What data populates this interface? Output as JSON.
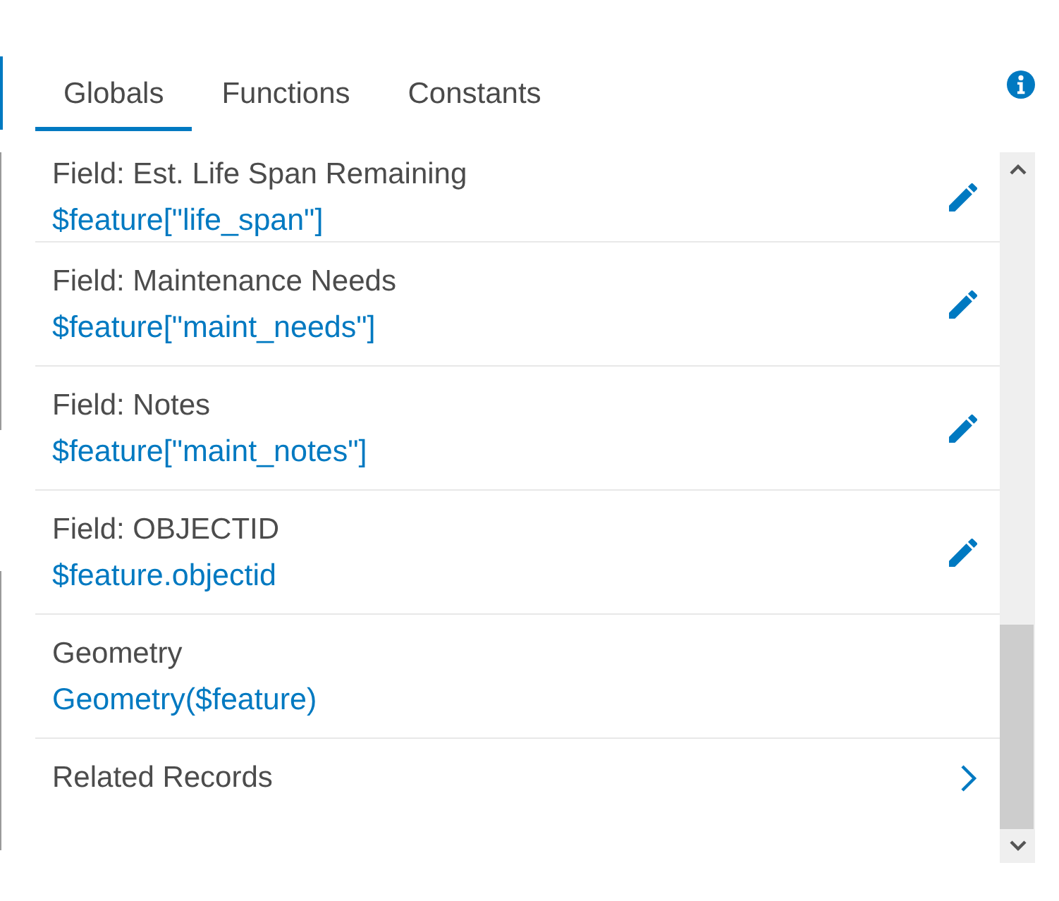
{
  "tabs": [
    {
      "label": "Globals",
      "selected": true
    },
    {
      "label": "Functions",
      "selected": false
    },
    {
      "label": "Constants",
      "selected": false
    }
  ],
  "rows": [
    {
      "kind": "editable",
      "title": "Field: Est. Life Span Remaining",
      "expression": "$feature[\"life_span\"]"
    },
    {
      "kind": "editable",
      "title": "Field: Maintenance Needs",
      "expression": "$feature[\"maint_needs\"]"
    },
    {
      "kind": "editable",
      "title": "Field: Notes",
      "expression": "$feature[\"maint_notes\"]"
    },
    {
      "kind": "editable",
      "title": "Field: OBJECTID",
      "expression": "$feature.objectid"
    },
    {
      "kind": "plain",
      "title": "Geometry",
      "expression": "Geometry($feature)"
    },
    {
      "kind": "navigable",
      "title": "Related Records"
    }
  ]
}
